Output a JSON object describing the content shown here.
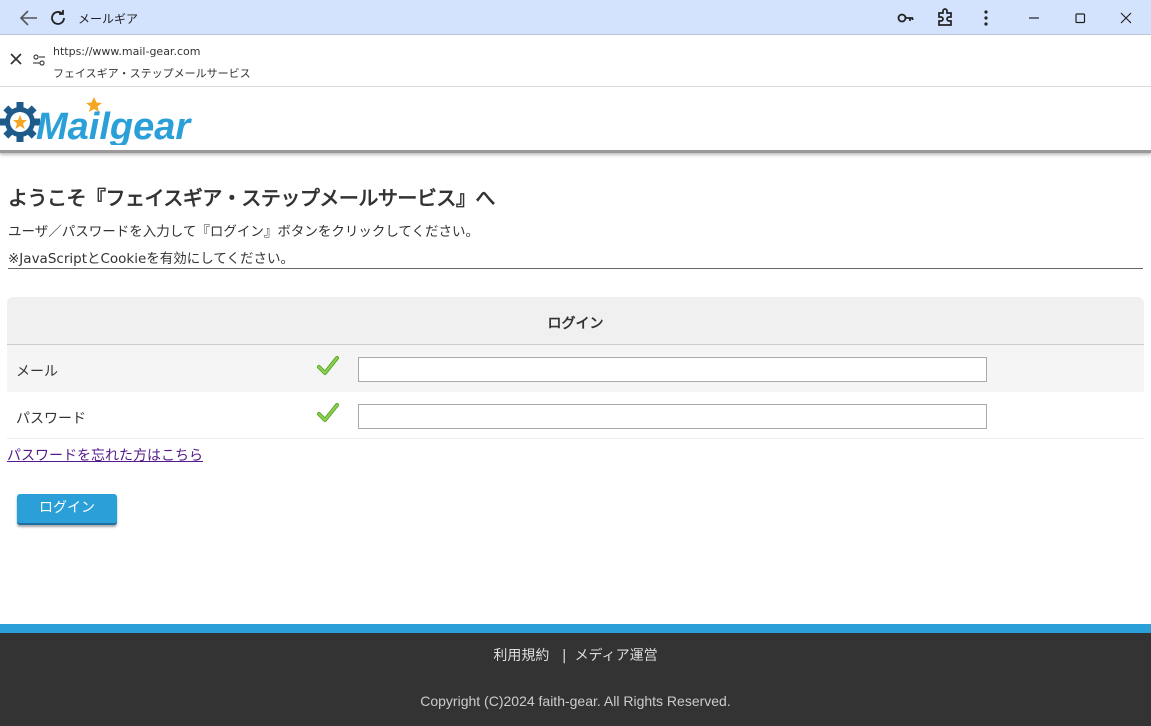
{
  "browser": {
    "tab_title": "メールギア",
    "url": "https://www.mail-gear.com",
    "page_title": "フェイスギア・ステップメールサービス"
  },
  "header": {
    "logo_text": "Mailgear"
  },
  "main": {
    "welcome": "ようこそ『フェイスギア・ステップメールサービス』へ",
    "instruction": "ユーザ／パスワードを入力して『ログイン』ボタンをクリックしてください。",
    "note": "※JavaScriptとCookieを有効にしてください。",
    "login_table": {
      "heading": "ログイン",
      "rows": [
        {
          "label": "メール",
          "value": ""
        },
        {
          "label": "パスワード",
          "value": ""
        }
      ]
    },
    "forgot_link": "パスワードを忘れた方はこちら",
    "login_button": "ログイン"
  },
  "footer": {
    "terms": "利用規約",
    "separator": "|",
    "operator": "メディア運営",
    "copyright": "Copyright (C)2024 faith-gear. All Rights Reserved."
  },
  "colors": {
    "accent": "#2a9fd8",
    "footer_bg": "#333333",
    "titlebar_bg": "#d3e3fd",
    "logo_star": "#f5a623"
  }
}
